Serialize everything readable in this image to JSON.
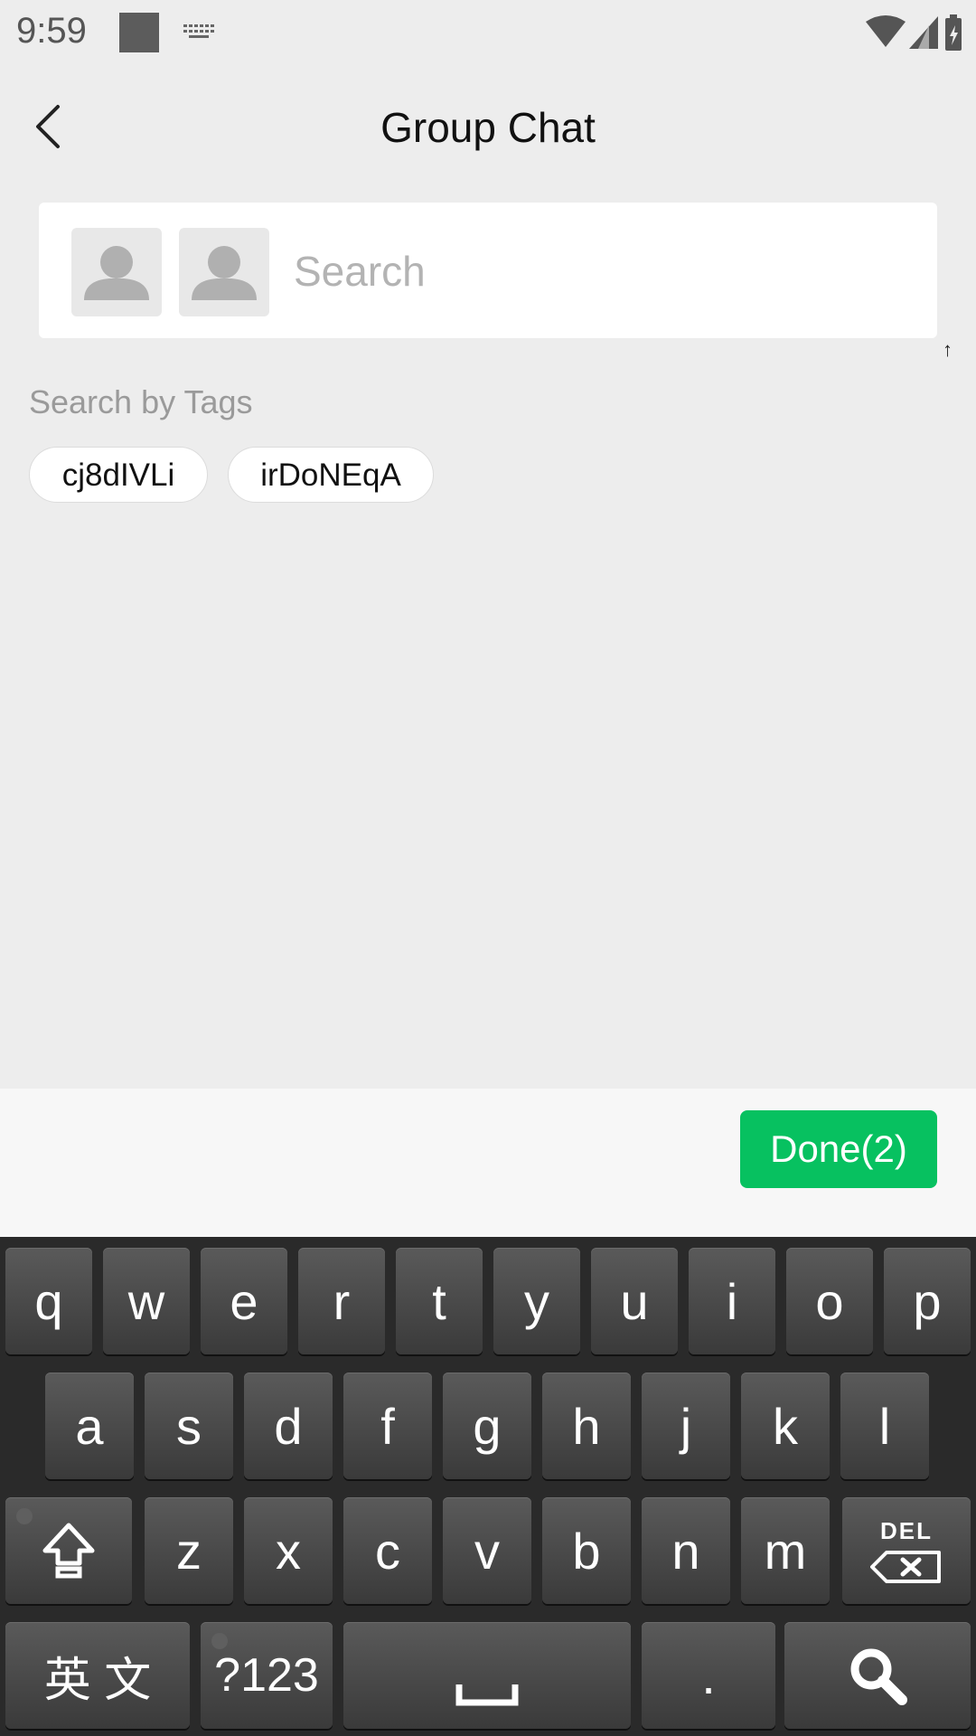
{
  "status_bar": {
    "time": "9:59",
    "icons": [
      "notification-square-icon",
      "keyboard-icon",
      "wifi-icon",
      "signal-icon",
      "battery-icon"
    ]
  },
  "header": {
    "title": "Group Chat",
    "back_icon": "chevron-left-icon"
  },
  "search": {
    "placeholder": "Search",
    "value": "",
    "selected_avatars": [
      "default-avatar-icon",
      "default-avatar-icon"
    ]
  },
  "tags": {
    "label": "Search by Tags",
    "items": [
      "cj8dIVLi",
      "irDoNEqA"
    ]
  },
  "action_bar": {
    "done_label": "Done(2)",
    "done_color": "#07c160"
  },
  "keyboard": {
    "row1": [
      "q",
      "w",
      "e",
      "r",
      "t",
      "y",
      "u",
      "i",
      "o",
      "p"
    ],
    "row2": [
      "a",
      "s",
      "d",
      "f",
      "g",
      "h",
      "j",
      "k",
      "l"
    ],
    "row3": [
      "z",
      "x",
      "c",
      "v",
      "b",
      "n",
      "m"
    ],
    "delete_label": "DEL",
    "lang_label": "英 文",
    "symbols_label": "?123",
    "period_label": "."
  }
}
